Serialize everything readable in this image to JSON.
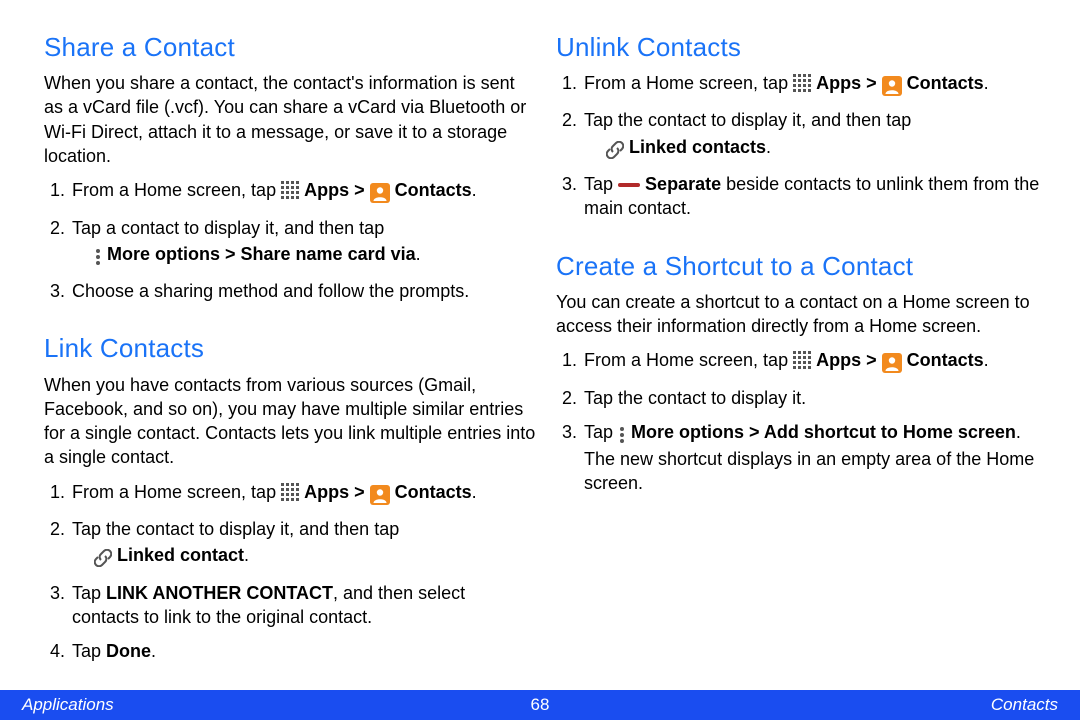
{
  "left": {
    "section1": {
      "heading": "Share a Contact",
      "intro": "When you share a contact, the contact's information is sent as a vCard file (.vcf). You can share a vCard via Bluetooth or Wi-Fi Direct, attach it to a message, or save it to a storage location.",
      "step1_pre": "From a Home screen, tap ",
      "apps_label": "Apps > ",
      "contacts_label": "Contacts",
      "step1_post": ".",
      "step2_line1": "Tap a contact to display it, and then tap",
      "step2_bold": "More options > Share name card via",
      "step2_post": ".",
      "step3": "Choose a sharing method and follow the prompts."
    },
    "section2": {
      "heading": "Link Contacts",
      "intro": "When you have contacts from various sources (Gmail, Facebook, and so on), you may have multiple similar entries for a single contact. Contacts lets you link multiple entries into a single contact.",
      "step1_pre": "From a Home screen, tap ",
      "apps_label": "Apps > ",
      "contacts_label": "Contacts",
      "step1_post": ".",
      "step2_line1": "Tap the contact to display it, and then tap",
      "step2_bold": "Linked contact",
      "step2_post": ".",
      "step3_pre": "Tap ",
      "step3_bold": "LINK ANOTHER CONTACT",
      "step3_post": ", and then select contacts to link to the original contact.",
      "step4_pre": "Tap ",
      "step4_bold": "Done",
      "step4_post": "."
    }
  },
  "right": {
    "section1": {
      "heading": "Unlink Contacts",
      "step1_pre": "From a Home screen, tap ",
      "apps_label": "Apps > ",
      "contacts_label": "Contacts",
      "step1_post": ".",
      "step2_line1": "Tap the contact to display it, and then tap",
      "step2_bold": "Linked contacts",
      "step2_post": ".",
      "step3_pre": "Tap ",
      "step3_bold": "Separate",
      "step3_post": " beside contacts to unlink them from the main contact."
    },
    "section2": {
      "heading": "Create a Shortcut to a Contact",
      "intro": "You can create a shortcut to a contact on a Home screen to access their information directly from a Home screen.",
      "step1_pre": "From a Home screen, tap ",
      "apps_label": "Apps > ",
      "contacts_label": "Contacts",
      "step1_post": ".",
      "step2": "Tap the contact to display it.",
      "step3_pre": "Tap ",
      "step3_bold": "More options > Add shortcut to Home screen",
      "step3_post": ". The new shortcut displays in an empty area of the Home screen."
    }
  },
  "footer": {
    "left": "Applications",
    "center": "68",
    "right": "Contacts"
  }
}
